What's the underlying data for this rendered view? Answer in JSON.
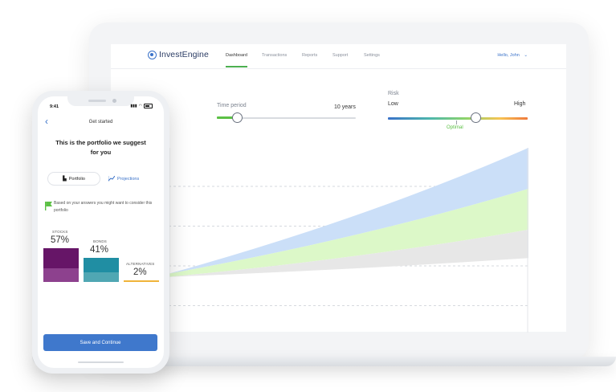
{
  "app": {
    "brand": "InvestEngine",
    "nav": [
      "Dashboard",
      "Transactions",
      "Reports",
      "Support",
      "Settings"
    ],
    "active_nav": "Dashboard",
    "user_menu": "Hello, John"
  },
  "controls": {
    "time_period": {
      "label": "Time period",
      "value": "10 years",
      "fraction": 0.15
    },
    "risk": {
      "label": "Risk",
      "low": "Low",
      "high": "High",
      "marker": "Optimal",
      "fraction": 0.63
    }
  },
  "projection_chart": {
    "type": "area",
    "layers": [
      {
        "color": "#cbdff8",
        "lower": [
          0.2,
          0.43,
          0.74
        ],
        "upper": [
          0.2,
          0.55,
          1.0
        ]
      },
      {
        "color": "#dcf8c8",
        "lower": [
          0.18,
          0.3,
          0.48
        ],
        "upper": [
          0.2,
          0.43,
          0.74
        ]
      },
      {
        "color": "#e7e7e7",
        "lower": [
          0.18,
          0.23,
          0.3
        ],
        "upper": [
          0.18,
          0.3,
          0.48
        ]
      }
    ],
    "gridlines": 4
  },
  "phone": {
    "time": "9:41",
    "title": "Get started",
    "back": "‹",
    "headline": "This is the portfolio we suggest for you",
    "tabs": {
      "portfolio": "Portfolio",
      "projections": "Projections"
    },
    "hint": "Based on your answers you might want to consider this portfolio",
    "allocation": [
      {
        "label": "STOCKS",
        "percent": "57%",
        "value": 57,
        "color": "#a14aa2"
      },
      {
        "label": "BONDS",
        "percent": "41%",
        "value": 41,
        "color": "#5bbecc"
      },
      {
        "label": "ALTERNATIVES",
        "percent": "2%",
        "value": 2,
        "color": "#f0b43a"
      }
    ],
    "cta": "Save and Continue"
  },
  "colors": {
    "accent": "#3a72c9",
    "green": "#5cc045",
    "button": "#3f78cc"
  }
}
